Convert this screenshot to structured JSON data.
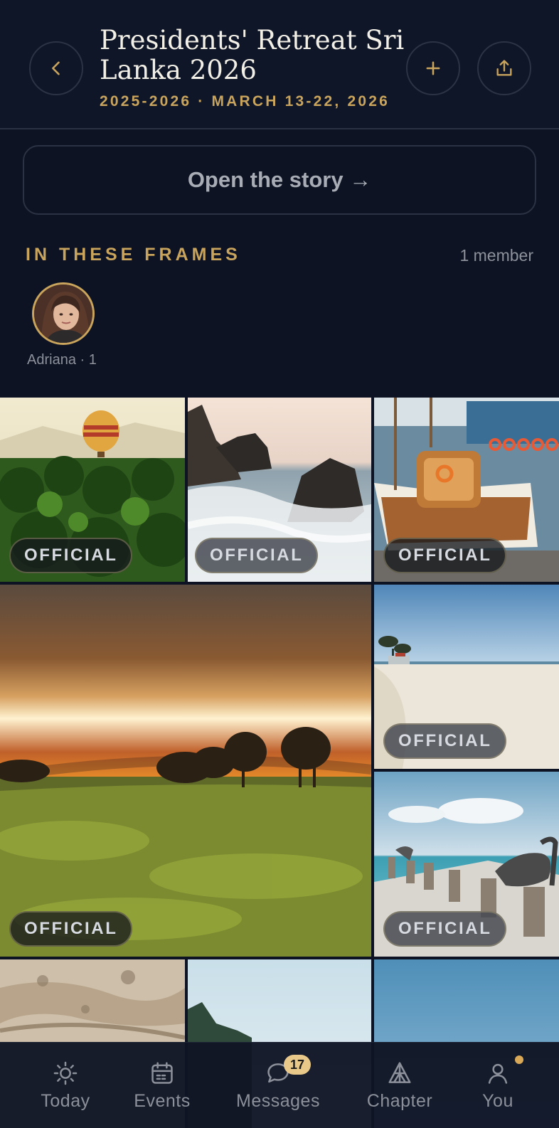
{
  "header": {
    "title": "Presidents' Retreat Sri Lanka 2026",
    "subtitle": "2025-2026 · MARCH 13-22, 2026",
    "back_icon": "chevron-left-icon",
    "add_icon": "plus-icon",
    "share_icon": "share-icon"
  },
  "story": {
    "label": "Open the story →"
  },
  "frames": {
    "title": "IN THESE FRAMES",
    "member_count": "1 member",
    "members": [
      {
        "label": "Adriana · 1"
      }
    ]
  },
  "photos": [
    {
      "scene": "hot-air-balloon-palms",
      "badge": "OFFICIAL"
    },
    {
      "scene": "rocky-coast-waves",
      "badge": "OFFICIAL"
    },
    {
      "scene": "wooden-boats-harbor",
      "badge": "OFFICIAL"
    },
    {
      "scene": "savanna-sunset",
      "badge": "OFFICIAL"
    },
    {
      "scene": "sandy-beach",
      "badge": "OFFICIAL"
    },
    {
      "scene": "pelicans-pier",
      "badge": "OFFICIAL"
    },
    {
      "scene": "aerial-terrain",
      "badge": ""
    },
    {
      "scene": "sky-treeline",
      "badge": ""
    },
    {
      "scene": "blue-sky",
      "badge": ""
    }
  ],
  "nav": {
    "items": [
      {
        "label": "Today",
        "icon": "sun-icon"
      },
      {
        "label": "Events",
        "icon": "calendar-icon"
      },
      {
        "label": "Messages",
        "icon": "chat-bubble-icon",
        "badge": "17"
      },
      {
        "label": "Chapter",
        "icon": "pyramid-icon"
      },
      {
        "label": "You",
        "icon": "person-icon"
      }
    ]
  },
  "colors": {
    "accent": "#c9a45d",
    "background": "#0d1322",
    "badge": "#e8c98a"
  }
}
